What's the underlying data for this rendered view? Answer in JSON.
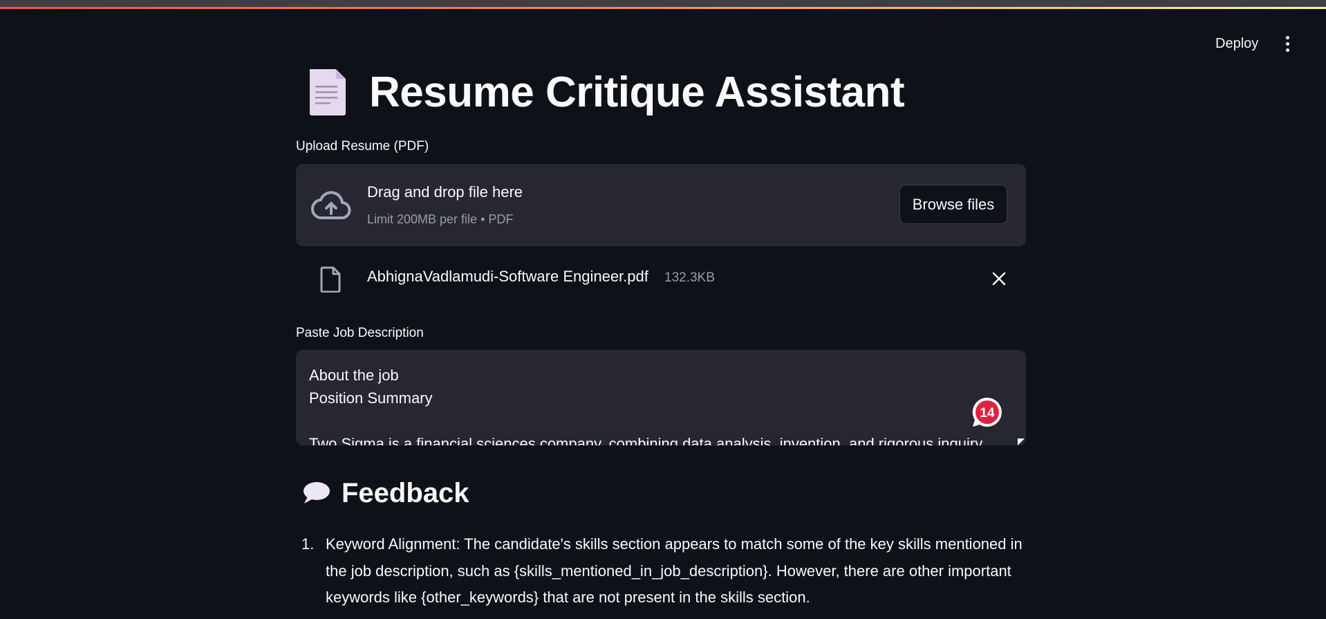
{
  "header": {
    "deploy_label": "Deploy",
    "menu_icon": "more-vertical-icon"
  },
  "title": {
    "icon": "page-facing-up-icon",
    "text": "Resume Critique Assistant"
  },
  "upload": {
    "label": "Upload Resume (PDF)",
    "dropzone_title": "Drag and drop file here",
    "dropzone_subtitle": "Limit 200MB per file • PDF",
    "browse_label": "Browse files",
    "icon": "cloud-upload-icon",
    "file": {
      "name": "AbhignaVadlamudi-Software Engineer.pdf",
      "size": "132.3KB",
      "icon": "file-icon",
      "remove_icon": "close-icon"
    }
  },
  "job_description": {
    "label": "Paste Job Description",
    "value": "About the job\nPosition Summary\n\nTwo Sigma is a financial sciences company, combining data analysis, invention, and rigorous inquiry",
    "badge_count": "14"
  },
  "feedback": {
    "icon": "speech-balloon-icon",
    "title": "Feedback",
    "items": [
      {
        "number": "1.",
        "text": "Keyword Alignment: The candidate's skills section appears to match some of the key skills mentioned in the job description, such as {skills_mentioned_in_job_description}. However, there are other important keywords like {other_keywords} that are not present in the skills section."
      }
    ]
  },
  "colors": {
    "background": "#0e1117",
    "panel": "#262730",
    "text": "#fafafa",
    "muted": "#9a9ca6",
    "badge": "#e0213f"
  }
}
